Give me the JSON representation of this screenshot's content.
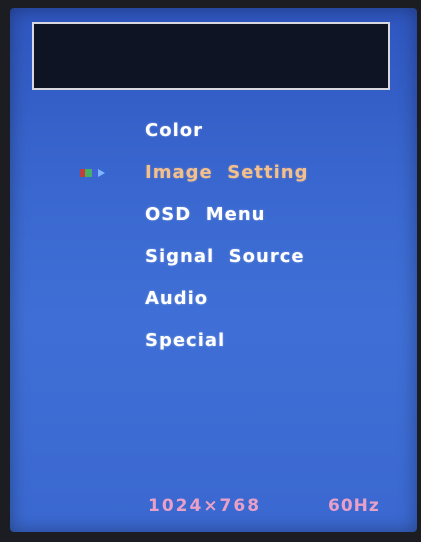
{
  "osd": {
    "header_text": "",
    "menu_items": [
      {
        "label": "Color",
        "selected": false
      },
      {
        "label": "Image  Setting",
        "selected": true
      },
      {
        "label": "OSD  Menu",
        "selected": false
      },
      {
        "label": "Signal  Source",
        "selected": false
      },
      {
        "label": "Audio",
        "selected": false
      },
      {
        "label": "Special",
        "selected": false
      }
    ],
    "selector_icon": "arrow-pointer-icon",
    "status": {
      "resolution": "1024×768",
      "refresh_rate": "60Hz"
    }
  },
  "colors": {
    "background": "#3a68d0",
    "menu_text": "#ffffff",
    "selected_text": "#f3c08c",
    "status_text": "#e9a0c8"
  }
}
